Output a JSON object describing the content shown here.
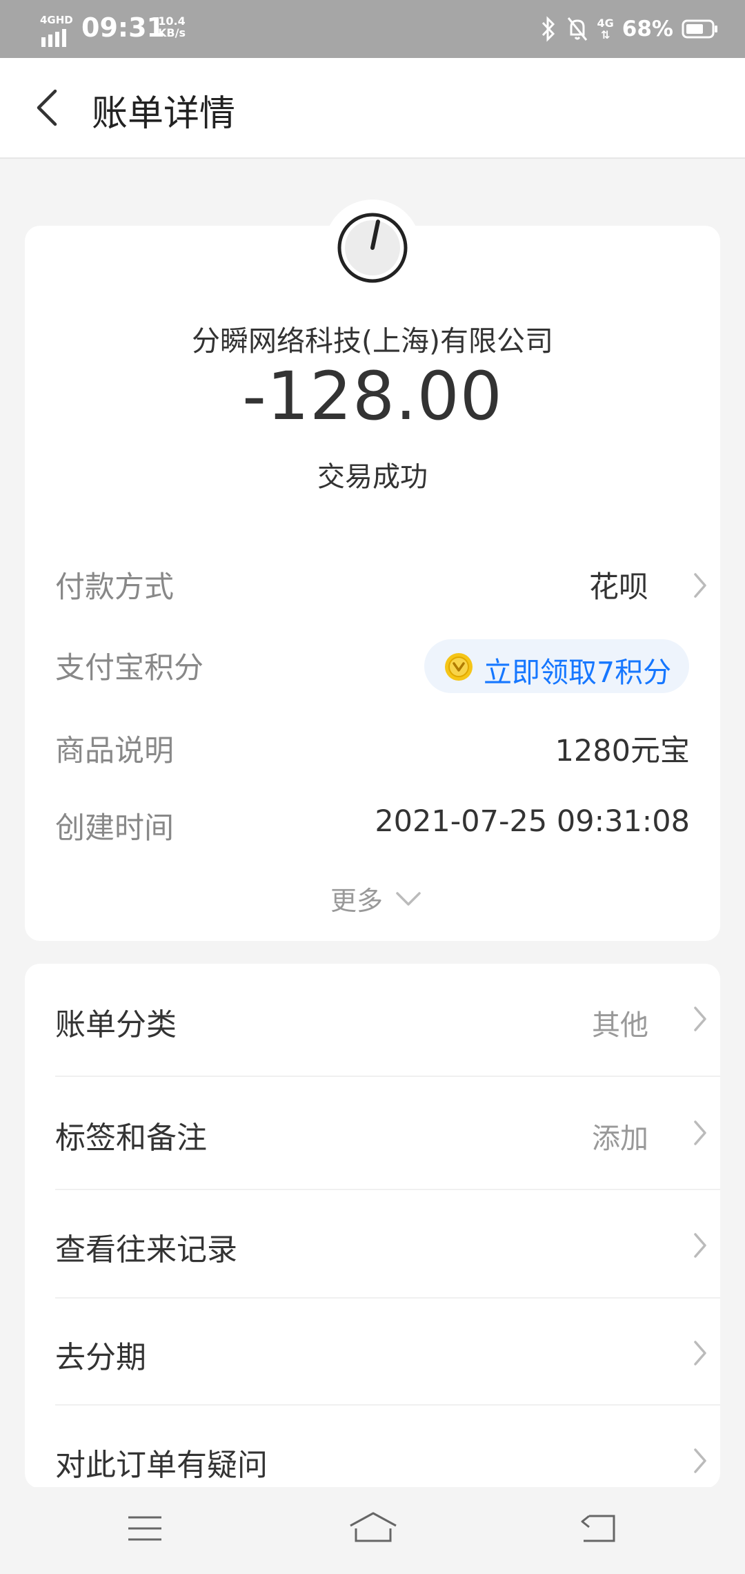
{
  "status_bar": {
    "network": "4GHD",
    "time": "09:31",
    "speed_value": "10.4",
    "speed_unit": "KB/s",
    "cell": "4G",
    "battery": "68%"
  },
  "header": {
    "title": "账单详情"
  },
  "transaction": {
    "merchant": "分瞬网络科技(上海)有限公司",
    "amount": "-128.00",
    "status": "交易成功"
  },
  "details": {
    "payment_method_label": "付款方式",
    "payment_method_value": "花呗",
    "points_label": "支付宝积分",
    "points_action": "立即领取7积分",
    "product_label": "商品说明",
    "product_value": "1280元宝",
    "created_label": "创建时间",
    "created_value": "2021-07-25 09:31:08",
    "more_label": "更多"
  },
  "actions": [
    {
      "label": "账单分类",
      "value": "其他"
    },
    {
      "label": "标签和备注",
      "value": "添加"
    },
    {
      "label": "查看往来记录",
      "value": ""
    },
    {
      "label": "去分期",
      "value": ""
    },
    {
      "label": "对此订单有疑问",
      "value": ""
    }
  ],
  "colors": {
    "accent": "#1677ff",
    "status_bar": "#a6a6a6",
    "coin": "#f5c518"
  }
}
